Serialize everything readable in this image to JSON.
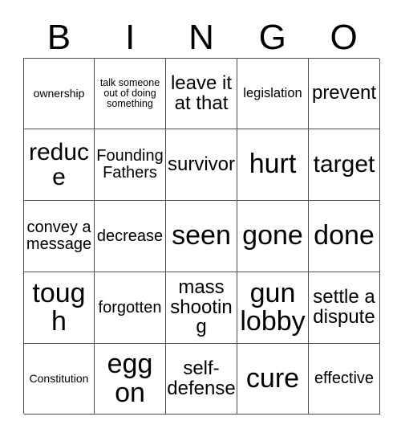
{
  "card": {
    "title": "BINGO",
    "columns": 5,
    "rows": 5,
    "grid_line_color": "#4d4d4d",
    "background_color": "#ffffff",
    "text_color": "#000000"
  },
  "header": {
    "letters": [
      "B",
      "I",
      "N",
      "G",
      "O"
    ]
  },
  "cells": [
    {
      "text": "ownership",
      "size": "s"
    },
    {
      "text": "talk someone out of doing something",
      "size": "xs"
    },
    {
      "text": "leave it at that",
      "size": "xl"
    },
    {
      "text": "legislation",
      "size": "m"
    },
    {
      "text": "prevent",
      "size": "xl"
    },
    {
      "text": "reduce",
      "size": "xxl"
    },
    {
      "text": "Founding Fathers",
      "size": "l"
    },
    {
      "text": "survivor",
      "size": "xl"
    },
    {
      "text": "hurt",
      "size": "xxxl"
    },
    {
      "text": "target",
      "size": "xxl"
    },
    {
      "text": "convey a message",
      "size": "l"
    },
    {
      "text": "decrease",
      "size": "l"
    },
    {
      "text": "seen",
      "size": "xxxl"
    },
    {
      "text": "gone",
      "size": "xxxl"
    },
    {
      "text": "done",
      "size": "xxxl"
    },
    {
      "text": "tough",
      "size": "xxxl"
    },
    {
      "text": "forgotten",
      "size": "l"
    },
    {
      "text": "mass shooting",
      "size": "xl"
    },
    {
      "text": "gun lobby",
      "size": "xxxl"
    },
    {
      "text": "settle a dispute",
      "size": "xl"
    },
    {
      "text": "Constitution",
      "size": "s"
    },
    {
      "text": "egg on",
      "size": "xxxl"
    },
    {
      "text": "self-defense",
      "size": "xl"
    },
    {
      "text": "cure",
      "size": "xxxl"
    },
    {
      "text": "effective",
      "size": "l"
    }
  ]
}
